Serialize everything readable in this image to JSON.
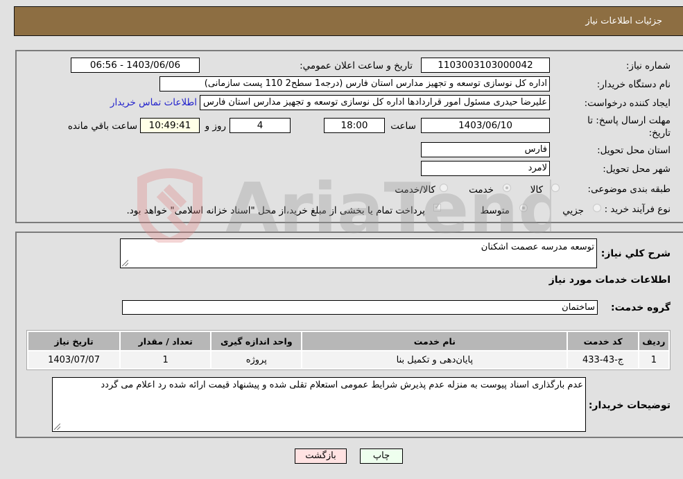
{
  "header": {
    "title": "جزئیات اطلاعات نیاز"
  },
  "details": {
    "need_number_label": "شماره نیاز:",
    "need_number": "1103003103000042",
    "announce_label": "تاریخ و ساعت اعلان عمومي:",
    "announce_value": "1403/06/06 - 06:56",
    "buyer_org_label": "نام دستگاه خریدار:",
    "buyer_org": "اداره کل نوسازی   توسعه و تجهیز مدارس استان فارس (درجه1  سطح2  110 پست سازمانی)",
    "creator_label": "ایجاد کننده درخواست:",
    "creator": "علیرضا حیدری مسئول امور قراردادها اداره کل نوسازی   توسعه و تجهیز مدارس استان فارس",
    "contact_link": "اطلاعات تماس خریدار",
    "deadline_label": "مهلت ارسال پاسخ: تا تاریخ:",
    "deadline_date": "1403/06/10",
    "time_label": "ساعت",
    "deadline_time": "18:00",
    "days_value": "4",
    "days_label": "روز و",
    "remaining_time": "10:49:41",
    "remaining_label": "ساعت باقي مانده",
    "province_label": "استان محل تحویل:",
    "province": "فارس",
    "city_label": "شهر محل تحویل:",
    "city": "لامرد",
    "category_label": "طبقه بندی موضوعی:",
    "category_options": [
      {
        "label": "کالا",
        "selected": false
      },
      {
        "label": "خدمت",
        "selected": true
      },
      {
        "label": "کالا/خدمت",
        "selected": false
      }
    ],
    "process_label": "نوع فرآیند خرید :",
    "process_options": [
      {
        "label": "جزيي",
        "selected": false
      },
      {
        "label": "متوسط",
        "selected": true
      }
    ],
    "treasury_checkbox_checked": true,
    "treasury_text": "پرداخت تمام یا بخشی از مبلغ خرید،از محل \"اسناد خزانه اسلامی\" خواهد بود."
  },
  "services": {
    "description_label": "شرح کلي نیاز:",
    "description": "توسعه مدرسه عصمت اشکنان",
    "section_title": "اطلاعات خدمات مورد نیاز",
    "group_label": "گروه خدمت:",
    "group_value": "ساختمان",
    "table": {
      "headers": [
        "ردیف",
        "کد خدمت",
        "نام خدمت",
        "واحد اندازه گیری",
        "تعداد / مقدار",
        "تاریخ نیاز"
      ],
      "rows": [
        [
          "1",
          "ج-43-433",
          "پایان‌دهی و تکمیل بنا",
          "پروژه",
          "1",
          "1403/07/07"
        ]
      ]
    },
    "buyer_notes_label": "توضیحات خریدار:",
    "buyer_notes": "عدم بارگذاری اسناد پیوست به منزله عدم پذیرش شرایط عمومی استعلام تقلی شده و پیشنهاد قیمت ارائه شده رد اعلام می گردد"
  },
  "buttons": {
    "print": "چاپ",
    "back": "بازگشت"
  },
  "watermark": {
    "text": "AriaTender.neT"
  }
}
